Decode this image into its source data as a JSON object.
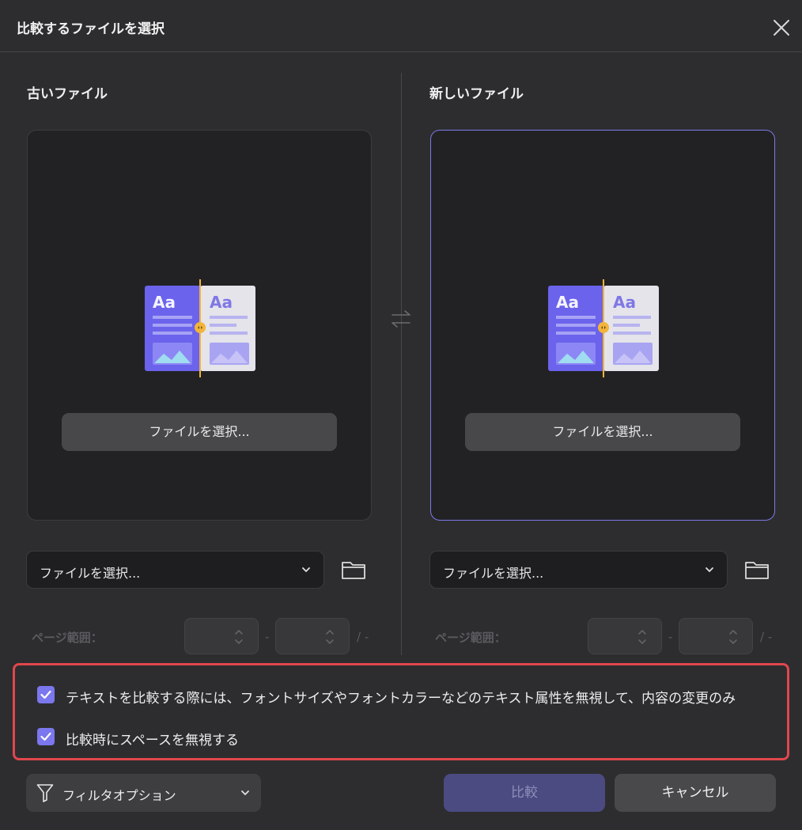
{
  "dialog": {
    "title": "比較するファイルを選択"
  },
  "old_file": {
    "label": "古いファイル",
    "choose_button": "ファイルを選択...",
    "select_value": "ファイルを選択...",
    "range_label": "ページ範囲：",
    "range_separator": "-",
    "range_total": "/ -"
  },
  "new_file": {
    "label": "新しいファイル",
    "choose_button": "ファイルを選択...",
    "select_value": "ファイルを選択...",
    "range_label": "ページ範囲：",
    "range_separator": "-",
    "range_total": "/ -"
  },
  "options": {
    "text_only": {
      "checked": true,
      "label": "テキストを比較する際には、フォントサイズやフォントカラーなどのテキスト属性を無視して、内容の変更のみ"
    },
    "ignore_spaces": {
      "checked": true,
      "label": "比較時にスペースを無視する"
    }
  },
  "footer": {
    "filter_label": "フィルタオプション",
    "compare_label": "比較",
    "cancel_label": "キャンセル"
  },
  "illustration": {
    "left_text": "Aa",
    "right_text": "Aa"
  },
  "colors": {
    "accent": "#7b77ee",
    "highlight_border": "#e0474c",
    "background": "#2d2d2f"
  }
}
